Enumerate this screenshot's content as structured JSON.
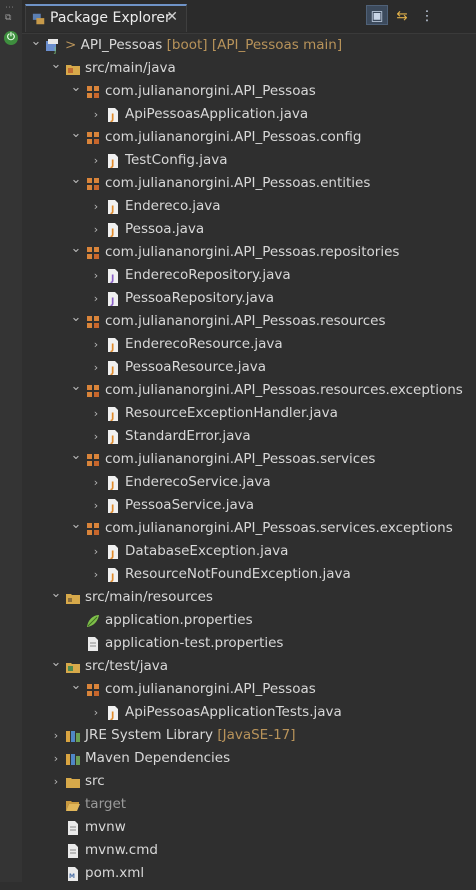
{
  "view": {
    "tab_title": "Package Explorer",
    "close_glyph": "✕",
    "toolbar": [
      {
        "name": "collapse-all-icon",
        "glyph": "▣",
        "active": true
      },
      {
        "name": "link-with-editor-icon",
        "glyph": "⇆",
        "active": false
      },
      {
        "name": "view-menu-icon",
        "glyph": "⋮",
        "active": false
      }
    ]
  },
  "tree": [
    {
      "depth": 0,
      "chev": "open",
      "icon": "project",
      "prefix": "> ",
      "label": "API_Pessoas",
      "decor": " [boot] [API_Pessoas main]"
    },
    {
      "depth": 1,
      "chev": "open",
      "icon": "src-folder",
      "label": "src/main/java"
    },
    {
      "depth": 2,
      "chev": "open",
      "icon": "package",
      "label": "com.juliananorgini.API_Pessoas"
    },
    {
      "depth": 3,
      "chev": "closed",
      "icon": "java-class",
      "label": "ApiPessoasApplication.java"
    },
    {
      "depth": 2,
      "chev": "open",
      "icon": "package",
      "label": "com.juliananorgini.API_Pessoas.config"
    },
    {
      "depth": 3,
      "chev": "closed",
      "icon": "java-class",
      "label": "TestConfig.java"
    },
    {
      "depth": 2,
      "chev": "open",
      "icon": "package",
      "label": "com.juliananorgini.API_Pessoas.entities"
    },
    {
      "depth": 3,
      "chev": "closed",
      "icon": "java-class",
      "label": "Endereco.java"
    },
    {
      "depth": 3,
      "chev": "closed",
      "icon": "java-class",
      "label": "Pessoa.java"
    },
    {
      "depth": 2,
      "chev": "open",
      "icon": "package",
      "label": "com.juliananorgini.API_Pessoas.repositories"
    },
    {
      "depth": 3,
      "chev": "closed",
      "icon": "java-interface",
      "label": "EnderecoRepository.java"
    },
    {
      "depth": 3,
      "chev": "closed",
      "icon": "java-interface",
      "label": "PessoaRepository.java"
    },
    {
      "depth": 2,
      "chev": "open",
      "icon": "package",
      "label": "com.juliananorgini.API_Pessoas.resources"
    },
    {
      "depth": 3,
      "chev": "closed",
      "icon": "java-class",
      "label": "EnderecoResource.java"
    },
    {
      "depth": 3,
      "chev": "closed",
      "icon": "java-class",
      "label": "PessoaResource.java"
    },
    {
      "depth": 2,
      "chev": "open",
      "icon": "package",
      "label": "com.juliananorgini.API_Pessoas.resources.exceptions"
    },
    {
      "depth": 3,
      "chev": "closed",
      "icon": "java-class",
      "label": "ResourceExceptionHandler.java"
    },
    {
      "depth": 3,
      "chev": "closed",
      "icon": "java-class",
      "label": "StandardError.java"
    },
    {
      "depth": 2,
      "chev": "open",
      "icon": "package",
      "label": "com.juliananorgini.API_Pessoas.services"
    },
    {
      "depth": 3,
      "chev": "closed",
      "icon": "java-class",
      "label": "EnderecoService.java"
    },
    {
      "depth": 3,
      "chev": "closed",
      "icon": "java-class",
      "label": "PessoaService.java"
    },
    {
      "depth": 2,
      "chev": "open",
      "icon": "package",
      "label": "com.juliananorgini.API_Pessoas.services.exceptions"
    },
    {
      "depth": 3,
      "chev": "closed",
      "icon": "java-class",
      "label": "DatabaseException.java"
    },
    {
      "depth": 3,
      "chev": "closed",
      "icon": "java-class",
      "label": "ResourceNotFoundException.java"
    },
    {
      "depth": 1,
      "chev": "open",
      "icon": "resource-folder",
      "label": "src/main/resources"
    },
    {
      "depth": 2,
      "chev": "none",
      "icon": "spring-properties",
      "label": "application.properties"
    },
    {
      "depth": 2,
      "chev": "none",
      "icon": "file",
      "label": "application-test.properties"
    },
    {
      "depth": 1,
      "chev": "open",
      "icon": "test-folder",
      "label": "src/test/java"
    },
    {
      "depth": 2,
      "chev": "open",
      "icon": "package",
      "label": "com.juliananorgini.API_Pessoas"
    },
    {
      "depth": 3,
      "chev": "closed",
      "icon": "java-class",
      "label": "ApiPessoasApplicationTests.java"
    },
    {
      "depth": 1,
      "chev": "closed",
      "icon": "library",
      "label": "JRE System Library",
      "decor": " [JavaSE-17]"
    },
    {
      "depth": 1,
      "chev": "closed",
      "icon": "library",
      "label": "Maven Dependencies"
    },
    {
      "depth": 1,
      "chev": "closed",
      "icon": "folder",
      "label": "src"
    },
    {
      "depth": 1,
      "chev": "none",
      "icon": "folder-open",
      "label": "target",
      "muted": true
    },
    {
      "depth": 1,
      "chev": "none",
      "icon": "file",
      "label": "mvnw"
    },
    {
      "depth": 1,
      "chev": "none",
      "icon": "file",
      "label": "mvnw.cmd"
    },
    {
      "depth": 1,
      "chev": "none",
      "icon": "xml-file",
      "label": "pom.xml"
    }
  ],
  "colors": {
    "background": "#2f2f2f",
    "text": "#d8d8d8",
    "decoration": "#b8935a",
    "muted": "#9a9a9a",
    "tab_accent": "#6f93c7"
  }
}
